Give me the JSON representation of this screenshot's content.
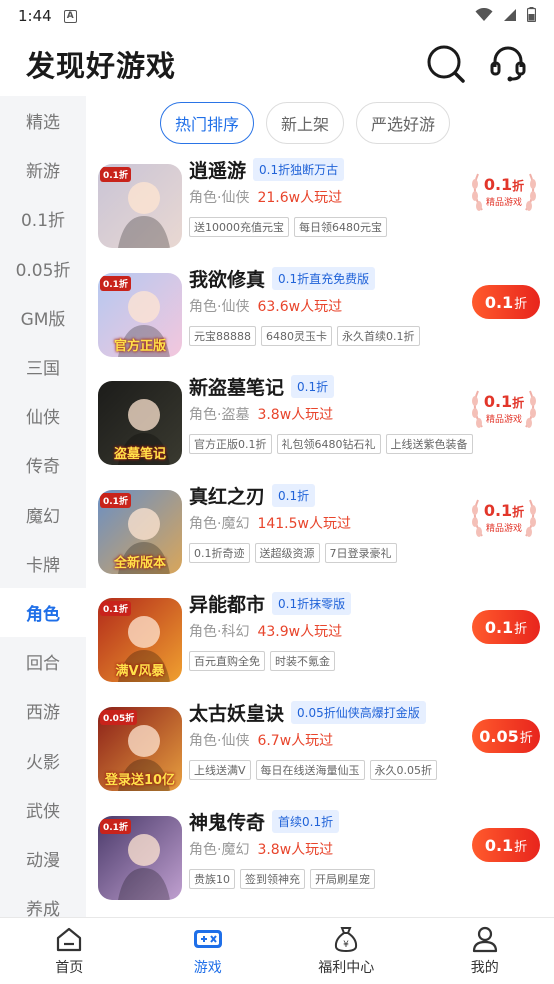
{
  "status": {
    "time": "1:44",
    "notif_letter": "A"
  },
  "header": {
    "title": "发现好游戏"
  },
  "sidebar": {
    "items": [
      {
        "label": "精选"
      },
      {
        "label": "新游"
      },
      {
        "label": "0.1折"
      },
      {
        "label": "0.05折"
      },
      {
        "label": "GM版"
      },
      {
        "label": "三国"
      },
      {
        "label": "仙侠"
      },
      {
        "label": "传奇"
      },
      {
        "label": "魔幻"
      },
      {
        "label": "卡牌"
      },
      {
        "label": "角色"
      },
      {
        "label": "回合"
      },
      {
        "label": "西游"
      },
      {
        "label": "火影"
      },
      {
        "label": "武侠"
      },
      {
        "label": "动漫"
      },
      {
        "label": "养成"
      }
    ],
    "active": "角色"
  },
  "tabs": [
    {
      "label": "热门排序"
    },
    {
      "label": "新上架"
    },
    {
      "label": "严选好游"
    }
  ],
  "games": [
    {
      "name": "逍遥游",
      "promo": "0.1折独断万古",
      "category": "角色·仙侠",
      "plays": "21.6w人玩过",
      "tags": [
        "送10000充值元宝",
        "每日领6480元宝"
      ],
      "action": "stamp",
      "stamp_value": "0.1",
      "stamp_unit": "折",
      "stamp_sub": "精品游戏",
      "icon_badge": "0.1折",
      "icon_caption": "",
      "icon_colors": [
        "#c9c4d6",
        "#e9d8d2"
      ]
    },
    {
      "name": "我欲修真",
      "promo": "0.1折直充免费版",
      "category": "角色·仙侠",
      "plays": "63.6w人玩过",
      "tags": [
        "元宝88888",
        "6480灵玉卡",
        "永久首续0.1折"
      ],
      "action": "button",
      "button_value": "0.1",
      "button_unit": "折",
      "icon_badge": "0.1折",
      "icon_caption": "官方正版",
      "icon_colors": [
        "#b5c8f0",
        "#f3c7dd"
      ]
    },
    {
      "name": "新盗墓笔记",
      "promo": "0.1折",
      "category": "角色·盗墓",
      "plays": "3.8w人玩过",
      "tags": [
        "官方正版0.1折",
        "礼包领6480钻石礼",
        "上线送紫色装备"
      ],
      "action": "stamp",
      "stamp_value": "0.1",
      "stamp_unit": "折",
      "stamp_sub": "精品游戏",
      "icon_badge": "",
      "icon_caption": "盗墓笔记",
      "icon_colors": [
        "#1c1c1a",
        "#3a3a30"
      ]
    },
    {
      "name": "真红之刃",
      "promo": "0.1折",
      "category": "角色·魔幻",
      "plays": "141.5w人玩过",
      "tags": [
        "0.1折奇迹",
        "送超级资源",
        "7日登录豪礼"
      ],
      "action": "stamp",
      "stamp_value": "0.1",
      "stamp_unit": "折",
      "stamp_sub": "精品游戏",
      "icon_badge": "0.1折",
      "icon_caption": "全新版本",
      "icon_colors": [
        "#6a8fc4",
        "#d9a65a"
      ]
    },
    {
      "name": "异能都市",
      "promo": "0.1折抹零版",
      "category": "角色·科幻",
      "plays": "43.9w人玩过",
      "tags": [
        "百元直购全免",
        "时装不氪金"
      ],
      "action": "button",
      "button_value": "0.1",
      "button_unit": "折",
      "icon_badge": "0.1折",
      "icon_caption": "满V风暴",
      "icon_colors": [
        "#b22a1a",
        "#f0a030"
      ]
    },
    {
      "name": "太古妖皇诀",
      "promo": "0.05折仙侠高爆打金版",
      "category": "角色·仙侠",
      "plays": "6.7w人玩过",
      "tags": [
        "上线送满V",
        "每日在线送海量仙玉",
        "永久0.05折"
      ],
      "action": "button",
      "button_value": "0.05",
      "button_unit": "折",
      "icon_badge": "0.05折",
      "icon_caption": "登录送10亿",
      "icon_colors": [
        "#8a1e18",
        "#e8a040"
      ]
    },
    {
      "name": "神鬼传奇",
      "promo": "首续0.1折",
      "category": "角色·魔幻",
      "plays": "3.8w人玩过",
      "tags": [
        "贵族10",
        "签到领神充",
        "开局刷星宠"
      ],
      "action": "button",
      "button_value": "0.1",
      "button_unit": "折",
      "icon_badge": "0.1折",
      "icon_caption": "",
      "icon_colors": [
        "#4a3a6a",
        "#c0a0d0"
      ]
    }
  ],
  "bottom_nav": [
    {
      "label": "首页",
      "icon": "home-icon"
    },
    {
      "label": "游戏",
      "icon": "gamepad-icon"
    },
    {
      "label": "福利中心",
      "icon": "money-bag-icon"
    },
    {
      "label": "我的",
      "icon": "profile-icon"
    }
  ],
  "colors": {
    "accent": "#1f6fe8",
    "price_red": "#e8452c",
    "sidebar_bg": "#f4f5f7"
  }
}
